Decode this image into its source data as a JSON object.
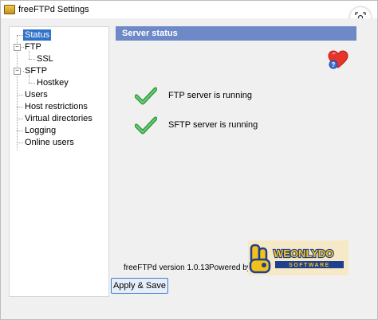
{
  "window": {
    "title": "freeFTPd Settings"
  },
  "tree": {
    "items": [
      {
        "label": "Status"
      },
      {
        "label": "FTP"
      },
      {
        "label": "SSL"
      },
      {
        "label": "SFTP"
      },
      {
        "label": "Hostkey"
      },
      {
        "label": "Users"
      },
      {
        "label": "Host restrictions"
      },
      {
        "label": "Virtual directories"
      },
      {
        "label": "Logging"
      },
      {
        "label": "Online users"
      }
    ],
    "selected": "Status"
  },
  "panel": {
    "header": "Server status",
    "status_rows": [
      {
        "text": "FTP server is running",
        "icon": "check-icon"
      },
      {
        "text": "SFTP server is running",
        "icon": "check-icon"
      }
    ],
    "version_text": "freeFTPd version 1.0.13",
    "powered_text": "Powered by",
    "logo": {
      "text": "WEONLYDO",
      "subtext": "SOFTWARE"
    }
  },
  "buttons": {
    "apply_label": "Apply & Save"
  },
  "colors": {
    "header_bg": "#6d89c8",
    "selection": "#3072c8",
    "check": "#3aa54a",
    "heart": "#e8332b",
    "button_border": "#3c7fcf"
  }
}
